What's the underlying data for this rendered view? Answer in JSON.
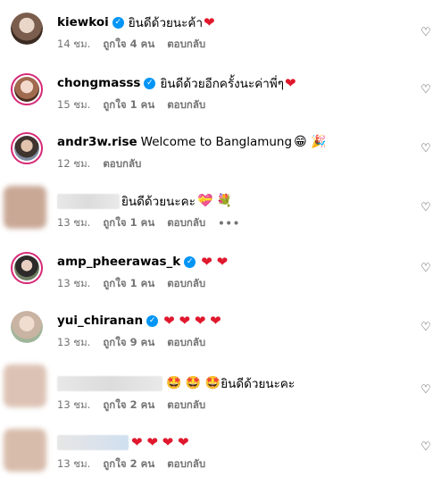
{
  "comments": [
    {
      "username": "kiewkoi",
      "verified": true,
      "text": "ยินดีด้วยนะค้า",
      "emojis": "❤",
      "time": "14 ชม.",
      "likes": "ถูกใจ 4 คน",
      "reply": "ตอบกลับ"
    },
    {
      "username": "chongmasss",
      "verified": true,
      "text": "ยินดีด้วยอีกครั้งนะค่าพี่ๆ",
      "emojis": "❤",
      "time": "15 ชม.",
      "likes": "ถูกใจ 1 คน",
      "reply": "ตอบกลับ"
    },
    {
      "username": "andr3w.rise",
      "verified": false,
      "text": "Welcome to Banglamung",
      "emojis": "😁 🎉",
      "time": "12 ชม.",
      "likes": "",
      "reply": "ตอบกลับ"
    },
    {
      "username": "",
      "verified": false,
      "text": "ยินดีด้วยนะคะ",
      "emojis": "💝 💐",
      "time": "13 ชม.",
      "likes": "ถูกใจ 1 คน",
      "reply": "ตอบกลับ",
      "more": "•••"
    },
    {
      "username": "amp_pheerawas_k",
      "verified": true,
      "text": "",
      "emojis": "❤ ❤",
      "time": "13 ชม.",
      "likes": "ถูกใจ 1 คน",
      "reply": "ตอบกลับ"
    },
    {
      "username": "yui_chiranan",
      "verified": true,
      "text": "",
      "emojis": "❤ ❤ ❤ ❤",
      "time": "13 ชม.",
      "likes": "ถูกใจ 9 คน",
      "reply": "ตอบกลับ"
    },
    {
      "username": "",
      "verified": false,
      "text": "ยินดีด้วยนะคะ",
      "emojis": "🤩 🤩 🤩",
      "time": "13 ชม.",
      "likes": "ถูกใจ 2 คน",
      "reply": "ตอบกลับ"
    },
    {
      "username": "",
      "verified": false,
      "text": "",
      "emojis": "❤ ❤ ❤ ❤",
      "time": "13 ชม.",
      "likes": "ถูกใจ 2 คน",
      "reply": "ตอบกลับ"
    }
  ],
  "icons": {
    "like": "heart-outline-icon",
    "verified": "verified-badge-icon"
  },
  "colors": {
    "verified": "#0095f6",
    "heart": "#e0182d",
    "meta": "#737373",
    "story_ring": "#d62976"
  }
}
